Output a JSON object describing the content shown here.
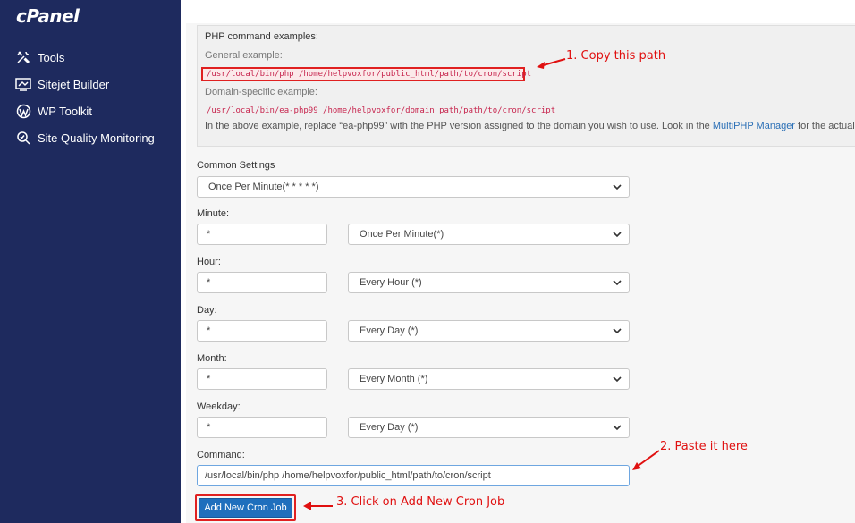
{
  "sidebar": {
    "logo": "cPanel",
    "items": [
      {
        "label": "Tools",
        "icon": "tools-icon"
      },
      {
        "label": "Sitejet Builder",
        "icon": "sitejet-icon"
      },
      {
        "label": "WP Toolkit",
        "icon": "wordpress-icon"
      },
      {
        "label": "Site Quality Monitoring",
        "icon": "site-quality-icon"
      }
    ]
  },
  "examples": {
    "title": "PHP command examples:",
    "general_label": "General example:",
    "general_code": "/usr/local/bin/php /home/helpvoxfor/public_html/path/to/cron/script",
    "domain_label": "Domain-specific example:",
    "domain_code": "/usr/local/bin/ea-php99 /home/helpvoxfor/domain_path/path/to/cron/script",
    "note_prefix": "In the above example, replace “ea-php99” with the PHP version assigned to the domain you wish to use. Look in the ",
    "note_link": "MultiPHP Manager",
    "note_suffix": " for the actual"
  },
  "form": {
    "common_settings_label": "Common Settings",
    "common_settings_value": "Once Per Minute(* * * * *)",
    "minute": {
      "label": "Minute:",
      "value": "*",
      "select": "Once Per Minute(*)"
    },
    "hour": {
      "label": "Hour:",
      "value": "*",
      "select": "Every Hour (*)"
    },
    "day": {
      "label": "Day:",
      "value": "*",
      "select": "Every Day (*)"
    },
    "month": {
      "label": "Month:",
      "value": "*",
      "select": "Every Month (*)"
    },
    "weekday": {
      "label": "Weekday:",
      "value": "*",
      "select": "Every Day (*)"
    },
    "command_label": "Command:",
    "command_value": "/usr/local/bin/php /home/helpvoxfor/public_html/path/to/cron/script",
    "submit_label": "Add New Cron Job"
  },
  "annotations": {
    "step1": "1. Copy this path",
    "step2": "2. Paste it here",
    "step3": "3. Click on Add New Cron Job",
    "color": "#e01010"
  },
  "colors": {
    "sidebar_bg": "#1e2a5e",
    "primary_button": "#1f6fbd",
    "link": "#2a6fb6",
    "code": "#c7254e"
  }
}
